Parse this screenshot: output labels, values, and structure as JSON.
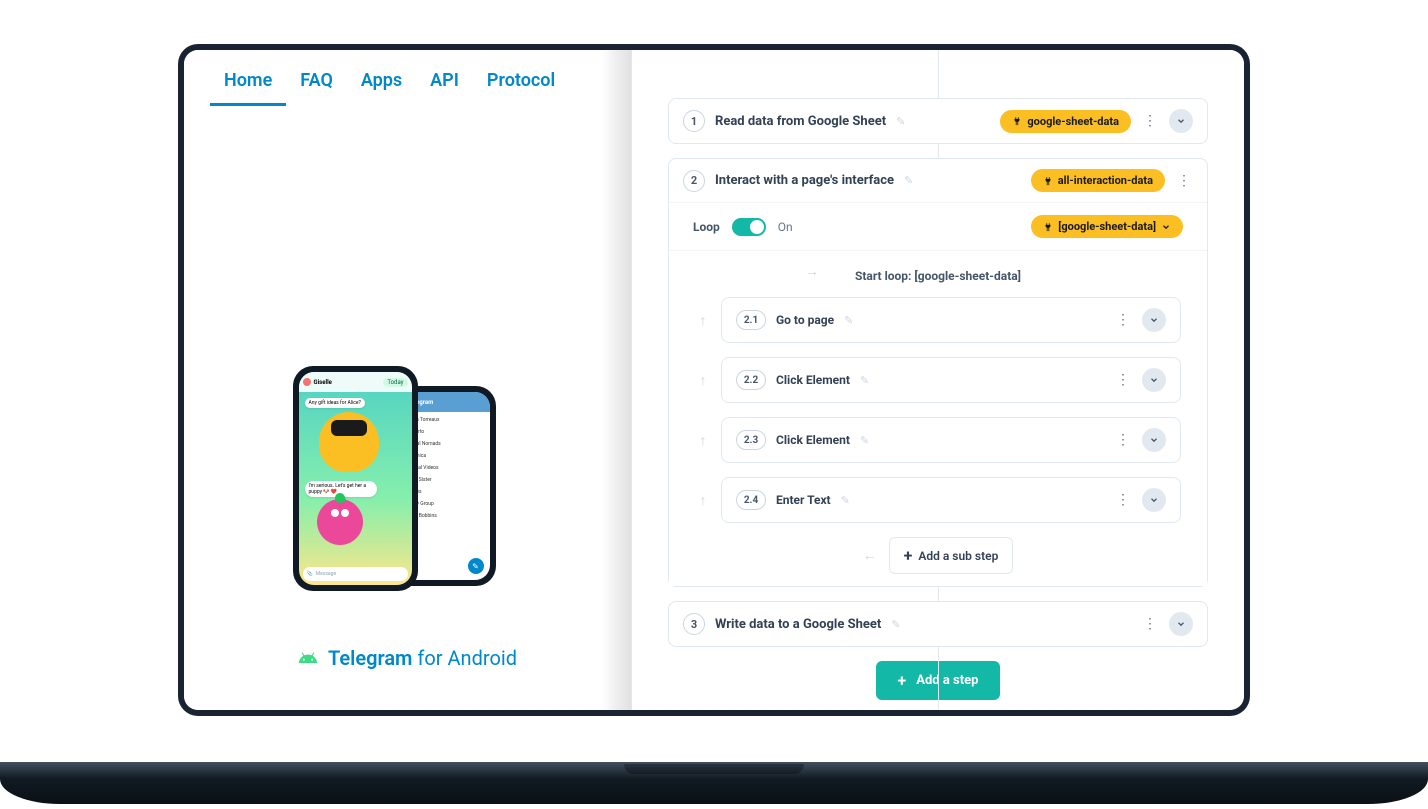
{
  "left": {
    "tabs": [
      "Home",
      "FAQ",
      "Apps",
      "API",
      "Protocol"
    ],
    "active_tab_index": 0,
    "promo_link_label": "Telegram",
    "promo_link_suffix": " for Android",
    "phone_a": {
      "name": "Giselle",
      "pill": "Today",
      "msg1": "Any gift ideas for Alice?",
      "msg2": "I'm serious. Let's get her a puppy 🐶 ❤️",
      "input_placeholder": "Message"
    },
    "phone_b": {
      "title": "Telegram",
      "chats": [
        "Alicia Torreaux",
        "Roberto",
        "Digital Nomads",
        "Veronica",
        "Animal Videos",
        "Little Sister",
        "James",
        "Study Group",
        "Alice Bobbins"
      ]
    }
  },
  "right": {
    "steps": [
      {
        "num": "1",
        "title": "Read data from Google Sheet",
        "pill": "google-sheet-data"
      },
      {
        "num": "2",
        "title": "Interact with a page's interface",
        "pill": "all-interaction-data",
        "loop": {
          "label": "Loop",
          "state": "On",
          "source_pill": "[google-sheet-data]",
          "start_label": "Start loop: [google-sheet-data]"
        },
        "subs": [
          {
            "num": "2.1",
            "title": "Go to page"
          },
          {
            "num": "2.2",
            "title": "Click Element"
          },
          {
            "num": "2.3",
            "title": "Click Element"
          },
          {
            "num": "2.4",
            "title": "Enter Text"
          }
        ]
      },
      {
        "num": "3",
        "title": "Write data to a Google Sheet"
      }
    ],
    "add_sub_label": "Add a sub step",
    "add_step_label": "Add a step"
  }
}
